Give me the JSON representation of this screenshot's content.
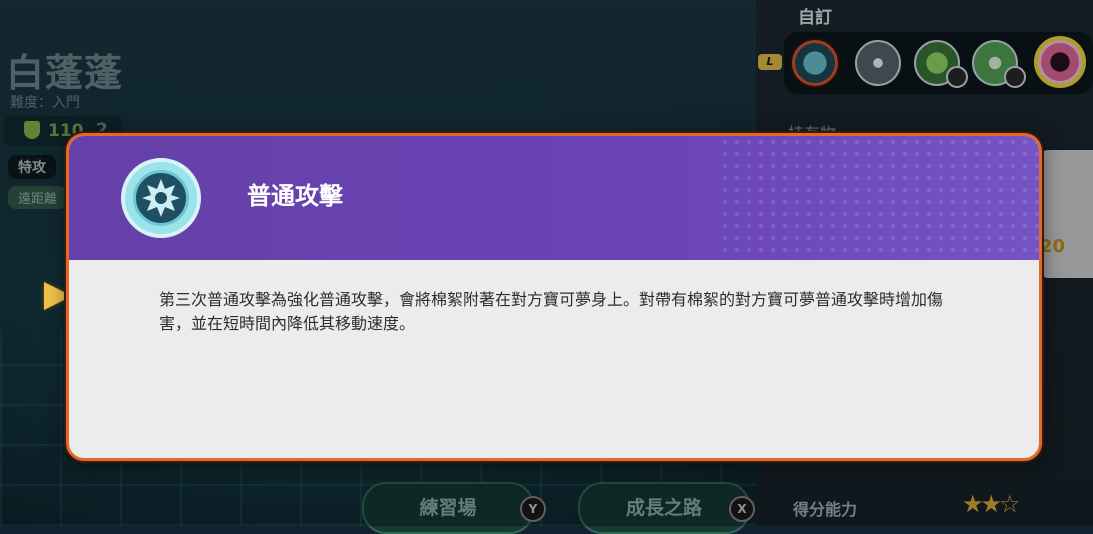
{
  "pokemon": {
    "name": "白蓬蓬",
    "difficulty": "難度：入門",
    "stat_value": "110",
    "stat_value_2": "2",
    "tag_primary": "特攻",
    "tag_secondary": "遠距離"
  },
  "right_panel": {
    "section_title": "自訂",
    "lock_badge": "L",
    "moves": [
      {
        "icon": "basic-attack-icon"
      },
      {
        "icon": "burst-icon"
      },
      {
        "icon": "leaf-move-icon"
      },
      {
        "icon": "sparkle-move-icon"
      },
      {
        "icon": "unite-move-icon"
      }
    ],
    "held_items_label": "持有物",
    "held_item_level": "20",
    "score_label": "得分能力",
    "score_stars": "★★☆"
  },
  "bottom_buttons": {
    "practice": "練習場",
    "practice_key": "Y",
    "growth": "成長之路",
    "growth_key": "X"
  },
  "modal": {
    "title": "普通攻擊",
    "description": "第三次普通攻擊為強化普通攻擊，會將棉絮附著在對方寶可夢身上。對帶有棉絮的對方寶可夢普通攻擊時增加傷害，並在短時間內降低其移動速度。"
  },
  "colors": {
    "modal_header": "#6a44b5",
    "modal_border": "#e06a2c",
    "modal_body": "#ececec",
    "accent_yellow": "#f0c34a"
  }
}
